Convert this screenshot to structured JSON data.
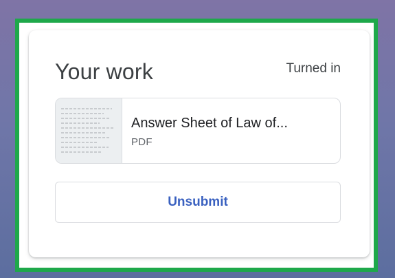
{
  "card": {
    "title": "Your work",
    "status": "Turned in"
  },
  "attachment": {
    "name": "Answer Sheet of Law of...",
    "type": "PDF"
  },
  "actions": {
    "unsubmit_label": "Unsubmit"
  },
  "colors": {
    "highlight_border": "#1ea84a",
    "button_text": "#3a61c0",
    "background": "#7a70a3"
  }
}
